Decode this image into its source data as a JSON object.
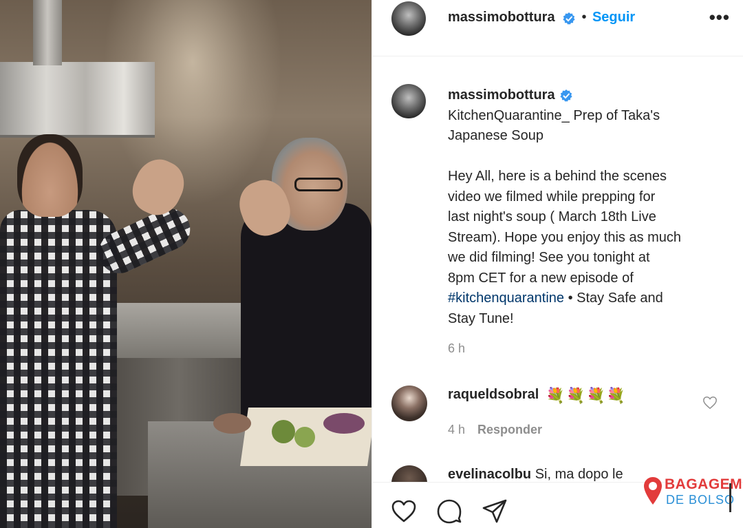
{
  "post": {
    "author": "massimobottura",
    "follow_label": "Seguir",
    "separator": "•",
    "more_label": "•••"
  },
  "caption": {
    "username": "massimobottura",
    "title_lines": [
      "KitchenQuarantine_ Prep of Taka's",
      "Japanese Soup"
    ],
    "body_lines": [
      "Hey All, here is a behind the scenes",
      "video we filmed while prepping for",
      "last night's soup ( March 18th Live",
      "Stream). Hope you enjoy this as much",
      "we did filming! See you tonight at",
      "8pm CET for a new episode of"
    ],
    "hashtag": "#kitchenquarantine",
    "after_hashtag": " • Stay Safe and",
    "last_line": "Stay Tune!",
    "time": "6 h"
  },
  "comments": [
    {
      "username": "raqueldsobral",
      "text": "💐💐💐💐",
      "time": "4 h",
      "reply_label": "Responder"
    },
    {
      "username": "evelinacolbu",
      "text": "Si, ma dopo le"
    }
  ],
  "icons": [
    "verified-badge-icon",
    "heart-icon",
    "comment-icon",
    "share-icon",
    "more-icon"
  ],
  "watermark": {
    "top": "BAGAGEM",
    "bottom": "DE BOLSO"
  },
  "colors": {
    "link": "#0095f6",
    "hashtag": "#00376b",
    "meta": "#8e8e8e",
    "watermark_red": "#e23b3b",
    "watermark_blue": "#2a8fd6"
  }
}
